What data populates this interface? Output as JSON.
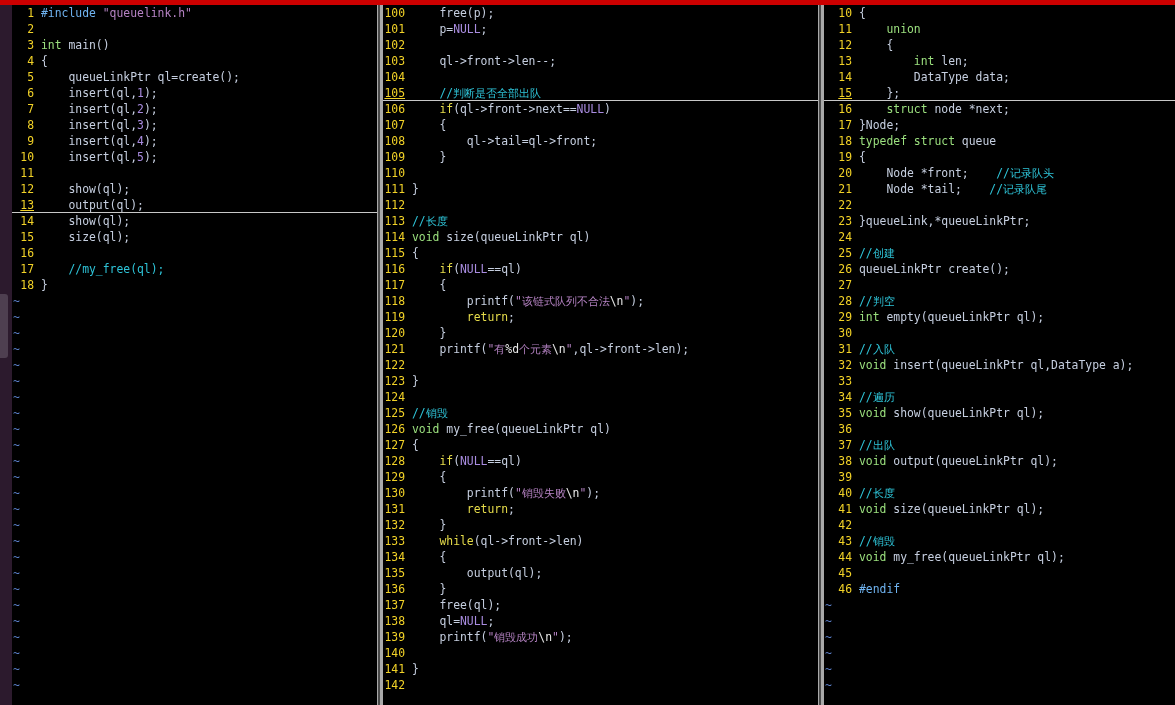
{
  "panes": [
    {
      "lines": [
        {
          "number": "1",
          "segments": [
            {
              "kind": "preproc",
              "text": "#include "
            },
            {
              "kind": "string",
              "text": "\"queuelink.h\""
            }
          ]
        },
        {
          "number": "2"
        },
        {
          "number": "3",
          "segments": [
            {
              "kind": "type",
              "text": "int"
            },
            {
              "kind": "plain",
              "text": " main()"
            }
          ]
        },
        {
          "number": "4",
          "segments": [
            {
              "kind": "plain",
              "text": "{"
            }
          ]
        },
        {
          "number": "5",
          "segments": [
            {
              "kind": "plain",
              "text": "    queueLinkPtr ql=create();"
            }
          ]
        },
        {
          "number": "6",
          "segments": [
            {
              "kind": "plain",
              "text": "    insert(ql,"
            },
            {
              "kind": "constant",
              "text": "1"
            },
            {
              "kind": "plain",
              "text": ");"
            }
          ]
        },
        {
          "number": "7",
          "segments": [
            {
              "kind": "plain",
              "text": "    insert(ql,"
            },
            {
              "kind": "constant",
              "text": "2"
            },
            {
              "kind": "plain",
              "text": ");"
            }
          ]
        },
        {
          "number": "8",
          "segments": [
            {
              "kind": "plain",
              "text": "    insert(ql,"
            },
            {
              "kind": "constant",
              "text": "3"
            },
            {
              "kind": "plain",
              "text": ");"
            }
          ]
        },
        {
          "number": "9",
          "segments": [
            {
              "kind": "plain",
              "text": "    insert(ql,"
            },
            {
              "kind": "constant",
              "text": "4"
            },
            {
              "kind": "plain",
              "text": ");"
            }
          ]
        },
        {
          "number": "10",
          "segments": [
            {
              "kind": "plain",
              "text": "    insert(ql,"
            },
            {
              "kind": "constant",
              "text": "5"
            },
            {
              "kind": "plain",
              "text": ");"
            }
          ]
        },
        {
          "number": "11"
        },
        {
          "number": "12",
          "segments": [
            {
              "kind": "plain",
              "text": "    show(ql);"
            }
          ]
        },
        {
          "number": "13",
          "cursorline": true,
          "segments": [
            {
              "kind": "plain",
              "text": "    output(ql);"
            }
          ]
        },
        {
          "number": "14",
          "segments": [
            {
              "kind": "plain",
              "text": "    show(ql);"
            }
          ]
        },
        {
          "number": "15",
          "segments": [
            {
              "kind": "plain",
              "text": "    size(ql);"
            }
          ]
        },
        {
          "number": "16"
        },
        {
          "number": "17",
          "segments": [
            {
              "kind": "comment",
              "text": "    //my_free(ql);"
            }
          ]
        },
        {
          "number": "18",
          "segments": [
            {
              "kind": "plain",
              "text": "}"
            }
          ]
        }
      ],
      "filler": [
        "~",
        "~",
        "~",
        "~",
        "~",
        "~",
        "~",
        "~",
        "~",
        "~",
        "~",
        "~",
        "~",
        "~",
        "~",
        "~",
        "~",
        "~",
        "~",
        "~",
        "~",
        "~",
        "~",
        "~",
        "~"
      ]
    },
    {
      "lines": [
        {
          "number": "100",
          "segments": [
            {
              "kind": "plain",
              "text": "    free(p);"
            }
          ]
        },
        {
          "number": "101",
          "segments": [
            {
              "kind": "plain",
              "text": "    p="
            },
            {
              "kind": "constant",
              "text": "NULL"
            },
            {
              "kind": "plain",
              "text": ";"
            }
          ]
        },
        {
          "number": "102"
        },
        {
          "number": "103",
          "segments": [
            {
              "kind": "plain",
              "text": "    ql->front->len--;"
            }
          ]
        },
        {
          "number": "104"
        },
        {
          "number": "105",
          "cursorline": true,
          "segments": [
            {
              "kind": "comment",
              "text": "    //判断是否全部出队"
            }
          ]
        },
        {
          "number": "106",
          "segments": [
            {
              "kind": "statement",
              "text": "    if"
            },
            {
              "kind": "plain",
              "text": "(ql->front->next=="
            },
            {
              "kind": "constant",
              "text": "NULL"
            },
            {
              "kind": "plain",
              "text": ")"
            }
          ]
        },
        {
          "number": "107",
          "segments": [
            {
              "kind": "plain",
              "text": "    {"
            }
          ]
        },
        {
          "number": "108",
          "segments": [
            {
              "kind": "plain",
              "text": "        ql->tail=ql->front;"
            }
          ]
        },
        {
          "number": "109",
          "segments": [
            {
              "kind": "plain",
              "text": "    }"
            }
          ]
        },
        {
          "number": "110"
        },
        {
          "number": "111",
          "segments": [
            {
              "kind": "plain",
              "text": "}"
            }
          ]
        },
        {
          "number": "112"
        },
        {
          "number": "113",
          "segments": [
            {
              "kind": "comment",
              "text": "//长度"
            }
          ]
        },
        {
          "number": "114",
          "segments": [
            {
              "kind": "type",
              "text": "void"
            },
            {
              "kind": "plain",
              "text": " size(queueLinkPtr ql)"
            }
          ]
        },
        {
          "number": "115",
          "segments": [
            {
              "kind": "plain",
              "text": "{"
            }
          ]
        },
        {
          "number": "116",
          "segments": [
            {
              "kind": "statement",
              "text": "    if"
            },
            {
              "kind": "plain",
              "text": "("
            },
            {
              "kind": "constant",
              "text": "NULL"
            },
            {
              "kind": "plain",
              "text": "==ql)"
            }
          ]
        },
        {
          "number": "117",
          "segments": [
            {
              "kind": "plain",
              "text": "    {"
            }
          ]
        },
        {
          "number": "118",
          "segments": [
            {
              "kind": "plain",
              "text": "        printf("
            },
            {
              "kind": "string",
              "text": "\"该链式队列不合法"
            },
            {
              "kind": "special",
              "text": "\\n"
            },
            {
              "kind": "string",
              "text": "\""
            },
            {
              "kind": "plain",
              "text": ");"
            }
          ]
        },
        {
          "number": "119",
          "segments": [
            {
              "kind": "statement",
              "text": "        return"
            },
            {
              "kind": "plain",
              "text": ";"
            }
          ]
        },
        {
          "number": "120",
          "segments": [
            {
              "kind": "plain",
              "text": "    }"
            }
          ]
        },
        {
          "number": "121",
          "segments": [
            {
              "kind": "plain",
              "text": "    printf("
            },
            {
              "kind": "string",
              "text": "\"有"
            },
            {
              "kind": "special",
              "text": "%d"
            },
            {
              "kind": "string",
              "text": "个元素"
            },
            {
              "kind": "special",
              "text": "\\n"
            },
            {
              "kind": "string",
              "text": "\""
            },
            {
              "kind": "plain",
              "text": ",ql->front->len);"
            }
          ]
        },
        {
          "number": "122"
        },
        {
          "number": "123",
          "segments": [
            {
              "kind": "plain",
              "text": "}"
            }
          ]
        },
        {
          "number": "124"
        },
        {
          "number": "125",
          "segments": [
            {
              "kind": "comment",
              "text": "//销毁"
            }
          ]
        },
        {
          "number": "126",
          "segments": [
            {
              "kind": "type",
              "text": "void"
            },
            {
              "kind": "plain",
              "text": " my_free(queueLinkPtr ql)"
            }
          ]
        },
        {
          "number": "127",
          "segments": [
            {
              "kind": "plain",
              "text": "{"
            }
          ]
        },
        {
          "number": "128",
          "segments": [
            {
              "kind": "statement",
              "text": "    if"
            },
            {
              "kind": "plain",
              "text": "("
            },
            {
              "kind": "constant",
              "text": "NULL"
            },
            {
              "kind": "plain",
              "text": "==ql)"
            }
          ]
        },
        {
          "number": "129",
          "segments": [
            {
              "kind": "plain",
              "text": "    {"
            }
          ]
        },
        {
          "number": "130",
          "segments": [
            {
              "kind": "plain",
              "text": "        printf("
            },
            {
              "kind": "string",
              "text": "\"销毁失败"
            },
            {
              "kind": "special",
              "text": "\\n"
            },
            {
              "kind": "string",
              "text": "\""
            },
            {
              "kind": "plain",
              "text": ");"
            }
          ]
        },
        {
          "number": "131",
          "segments": [
            {
              "kind": "statement",
              "text": "        return"
            },
            {
              "kind": "plain",
              "text": ";"
            }
          ]
        },
        {
          "number": "132",
          "segments": [
            {
              "kind": "plain",
              "text": "    }"
            }
          ]
        },
        {
          "number": "133",
          "segments": [
            {
              "kind": "statement",
              "text": "    while"
            },
            {
              "kind": "plain",
              "text": "(ql->front->len)"
            }
          ]
        },
        {
          "number": "134",
          "segments": [
            {
              "kind": "plain",
              "text": "    {"
            }
          ]
        },
        {
          "number": "135",
          "segments": [
            {
              "kind": "plain",
              "text": "        output(ql);"
            }
          ]
        },
        {
          "number": "136",
          "segments": [
            {
              "kind": "plain",
              "text": "    }"
            }
          ]
        },
        {
          "number": "137",
          "segments": [
            {
              "kind": "plain",
              "text": "    free(ql);"
            }
          ]
        },
        {
          "number": "138",
          "segments": [
            {
              "kind": "plain",
              "text": "    ql="
            },
            {
              "kind": "constant",
              "text": "NULL"
            },
            {
              "kind": "plain",
              "text": ";"
            }
          ]
        },
        {
          "number": "139",
          "segments": [
            {
              "kind": "plain",
              "text": "    printf("
            },
            {
              "kind": "string",
              "text": "\"销毁成功"
            },
            {
              "kind": "special",
              "text": "\\n"
            },
            {
              "kind": "string",
              "text": "\""
            },
            {
              "kind": "plain",
              "text": ");"
            }
          ]
        },
        {
          "number": "140"
        },
        {
          "number": "141",
          "segments": [
            {
              "kind": "plain",
              "text": "}"
            }
          ]
        },
        {
          "number": "142"
        }
      ]
    },
    {
      "lines": [
        {
          "number": "10",
          "segments": [
            {
              "kind": "plain",
              "text": "{"
            }
          ]
        },
        {
          "number": "11",
          "segments": [
            {
              "kind": "type",
              "text": "    union"
            }
          ]
        },
        {
          "number": "12",
          "segments": [
            {
              "kind": "plain",
              "text": "    {"
            }
          ]
        },
        {
          "number": "13",
          "segments": [
            {
              "kind": "type",
              "text": "        int"
            },
            {
              "kind": "plain",
              "text": " len;"
            }
          ]
        },
        {
          "number": "14",
          "segments": [
            {
              "kind": "plain",
              "text": "        DataType data;"
            }
          ]
        },
        {
          "number": "15",
          "cursorline": true,
          "segments": [
            {
              "kind": "plain",
              "text": "    };"
            }
          ]
        },
        {
          "number": "16",
          "segments": [
            {
              "kind": "type",
              "text": "    struct"
            },
            {
              "kind": "plain",
              "text": " node *next;"
            }
          ]
        },
        {
          "number": "17",
          "segments": [
            {
              "kind": "plain",
              "text": "}Node;"
            }
          ]
        },
        {
          "number": "18",
          "segments": [
            {
              "kind": "type",
              "text": "typedef struct"
            },
            {
              "kind": "plain",
              "text": " queue"
            }
          ]
        },
        {
          "number": "19",
          "segments": [
            {
              "kind": "plain",
              "text": "{"
            }
          ]
        },
        {
          "number": "20",
          "segments": [
            {
              "kind": "plain",
              "text": "    Node *front;    "
            },
            {
              "kind": "comment",
              "text": "//记录队头"
            }
          ]
        },
        {
          "number": "21",
          "segments": [
            {
              "kind": "plain",
              "text": "    Node *tail;    "
            },
            {
              "kind": "comment",
              "text": "//记录队尾"
            }
          ]
        },
        {
          "number": "22"
        },
        {
          "number": "23",
          "segments": [
            {
              "kind": "plain",
              "text": "}queueLink,*queueLinkPtr;"
            }
          ]
        },
        {
          "number": "24"
        },
        {
          "number": "25",
          "segments": [
            {
              "kind": "comment",
              "text": "//创建"
            }
          ]
        },
        {
          "number": "26",
          "segments": [
            {
              "kind": "plain",
              "text": "queueLinkPtr create();"
            }
          ]
        },
        {
          "number": "27"
        },
        {
          "number": "28",
          "segments": [
            {
              "kind": "comment",
              "text": "//判空"
            }
          ]
        },
        {
          "number": "29",
          "segments": [
            {
              "kind": "type",
              "text": "int"
            },
            {
              "kind": "plain",
              "text": " empty(queueLinkPtr ql);"
            }
          ]
        },
        {
          "number": "30"
        },
        {
          "number": "31",
          "segments": [
            {
              "kind": "comment",
              "text": "//入队"
            }
          ]
        },
        {
          "number": "32",
          "segments": [
            {
              "kind": "type",
              "text": "void"
            },
            {
              "kind": "plain",
              "text": " insert(queueLinkPtr ql,DataType a);"
            }
          ]
        },
        {
          "number": "33"
        },
        {
          "number": "34",
          "segments": [
            {
              "kind": "comment",
              "text": "//遍历"
            }
          ]
        },
        {
          "number": "35",
          "segments": [
            {
              "kind": "type",
              "text": "void"
            },
            {
              "kind": "plain",
              "text": " show(queueLinkPtr ql);"
            }
          ]
        },
        {
          "number": "36"
        },
        {
          "number": "37",
          "segments": [
            {
              "kind": "comment",
              "text": "//出队"
            }
          ]
        },
        {
          "number": "38",
          "segments": [
            {
              "kind": "type",
              "text": "void"
            },
            {
              "kind": "plain",
              "text": " output(queueLinkPtr ql);"
            }
          ]
        },
        {
          "number": "39"
        },
        {
          "number": "40",
          "segments": [
            {
              "kind": "comment",
              "text": "//长度"
            }
          ]
        },
        {
          "number": "41",
          "segments": [
            {
              "kind": "type",
              "text": "void"
            },
            {
              "kind": "plain",
              "text": " size(queueLinkPtr ql);"
            }
          ]
        },
        {
          "number": "42"
        },
        {
          "number": "43",
          "segments": [
            {
              "kind": "comment",
              "text": "//销毁"
            }
          ]
        },
        {
          "number": "44",
          "segments": [
            {
              "kind": "type",
              "text": "void"
            },
            {
              "kind": "plain",
              "text": " my_free(queueLinkPtr ql);"
            }
          ]
        },
        {
          "number": "45"
        },
        {
          "number": "46",
          "segments": [
            {
              "kind": "preproc",
              "text": "#endif"
            }
          ]
        }
      ],
      "filler": [
        "~",
        "~",
        "~",
        "~",
        "~",
        "~"
      ]
    }
  ]
}
